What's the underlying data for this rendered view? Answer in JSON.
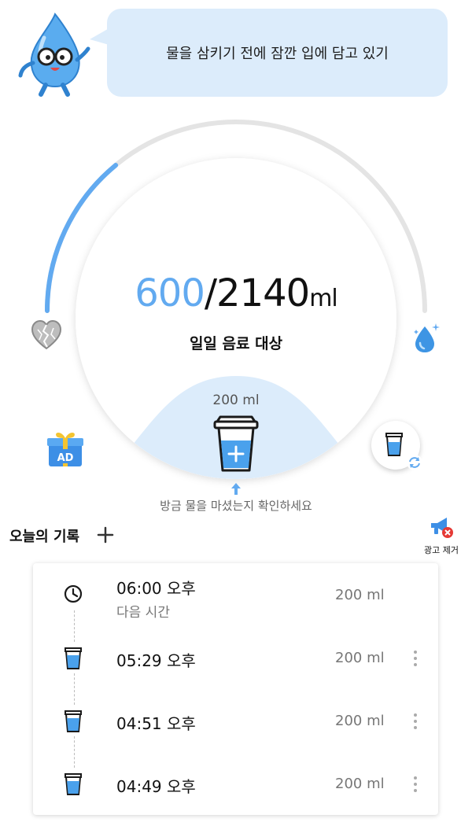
{
  "tip": {
    "text": "물을 삼키기 전에 잠깐 입에 담고 있기"
  },
  "progress": {
    "current": "600",
    "separator": "/",
    "total": "2140",
    "unit": "ml",
    "fraction": 0.28,
    "label": "일일 음료 대상"
  },
  "cup": {
    "amount_label": "200 ml",
    "hint": "방금 물을 마셨는지 확인하세요"
  },
  "records": {
    "title": "오늘의 기록",
    "remove_ads_label": "광고 제거",
    "items": [
      {
        "time": "06:00 오후",
        "sub": "다음 시간",
        "volume": "200 ml",
        "icon": "clock-icon"
      },
      {
        "time": "05:29 오후",
        "volume": "200 ml",
        "icon": "cup-icon"
      },
      {
        "time": "04:51 오후",
        "volume": "200 ml",
        "icon": "cup-icon"
      },
      {
        "time": "04:49 오후",
        "volume": "200 ml",
        "icon": "cup-icon"
      }
    ]
  },
  "colors": {
    "accent": "#62aaf0",
    "light_blue": "#dcecfb",
    "track": "#e4e4e4"
  }
}
